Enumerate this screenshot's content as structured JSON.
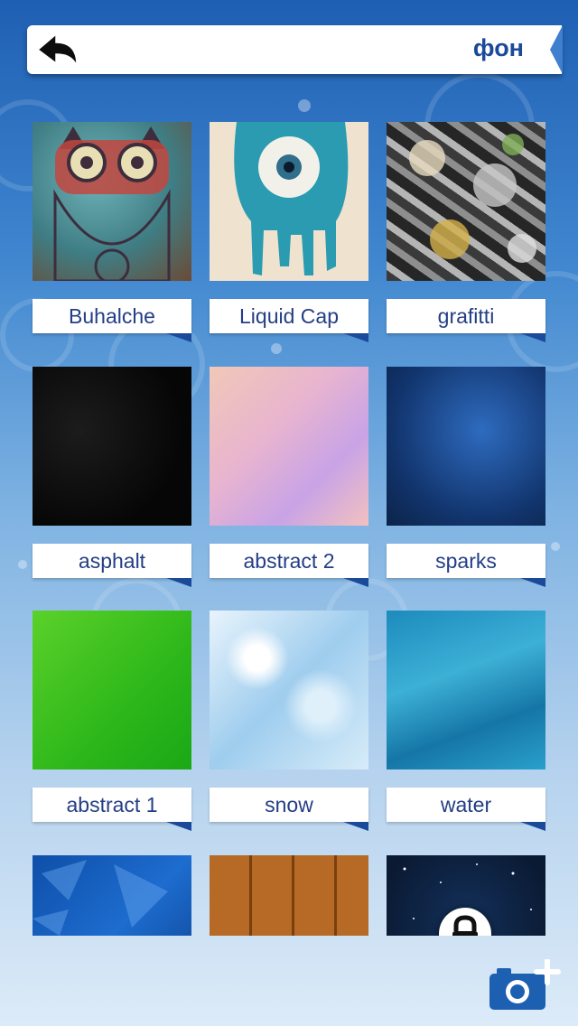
{
  "header": {
    "title": "фон"
  },
  "backgrounds": [
    {
      "label": "Buhalche"
    },
    {
      "label": "Liquid Cap"
    },
    {
      "label": "grafitti"
    },
    {
      "label": "asphalt"
    },
    {
      "label": "abstract 2"
    },
    {
      "label": "sparks"
    },
    {
      "label": "abstract 1"
    },
    {
      "label": "snow"
    },
    {
      "label": "water"
    }
  ],
  "colors": {
    "accent": "#1b4a9a",
    "label_text": "#233e86"
  },
  "icons": {
    "back": "back-arrow-icon",
    "lock": "lock-icon",
    "add_photo": "camera-plus-icon"
  }
}
